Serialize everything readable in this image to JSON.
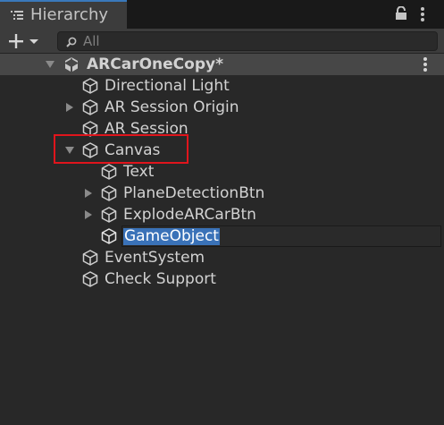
{
  "window": {
    "tab_title": "Hierarchy",
    "tab_icon": "list-icon",
    "lock_icon": "lock-icon",
    "menu_icon": "vertical-ellipsis-icon"
  },
  "toolbar": {
    "add_icon": "plus-icon",
    "dropdown_icon": "chevron-down-icon",
    "search_placeholder": "All",
    "search_icon": "search-icon"
  },
  "tree": {
    "scene": {
      "name": "ARCarOneCopy*",
      "icon": "unity-logo-icon",
      "expanded": true
    },
    "items": [
      {
        "label": "Directional Light",
        "icon": "cube-icon",
        "has_children": false
      },
      {
        "label": "AR Session Origin",
        "icon": "cube-icon",
        "has_children": true,
        "expanded": false
      },
      {
        "label": "AR Session",
        "icon": "cube-icon",
        "has_children": false
      },
      {
        "label": "Canvas",
        "icon": "cube-icon",
        "has_children": true,
        "expanded": true,
        "highlighted": true
      },
      {
        "label": "Text",
        "icon": "cube-icon",
        "has_children": false
      },
      {
        "label": "PlaneDetectionBtn",
        "icon": "cube-icon",
        "has_children": true,
        "expanded": false
      },
      {
        "label": "ExplodeARCarBtn",
        "icon": "cube-icon",
        "has_children": true,
        "expanded": false
      },
      {
        "label": "GameObject",
        "icon": "cube-outline-icon",
        "has_children": false,
        "renaming": true
      },
      {
        "label": "EventSystem",
        "icon": "cube-icon",
        "has_children": false
      },
      {
        "label": "Check Support",
        "icon": "cube-icon",
        "has_children": false
      }
    ]
  },
  "colors": {
    "background": "#282828",
    "selection": "#3a72b8",
    "highlight_box": "#e0151c",
    "tab_accent": "#3a79bb"
  }
}
